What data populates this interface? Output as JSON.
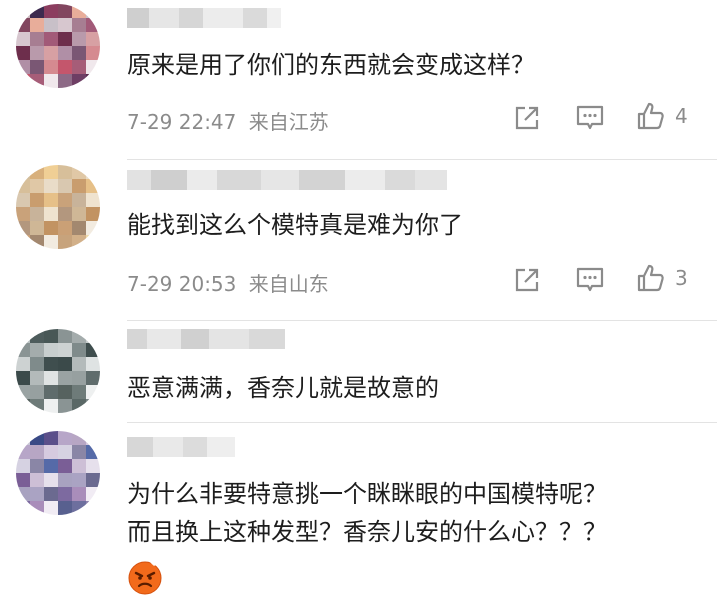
{
  "comments": [
    {
      "text_lines": [
        "原来是用了你们的东西就会变成这样？"
      ],
      "time": "7-29 22:47",
      "location": "来自江苏",
      "likes": "4",
      "avatar_palette": [
        "#c9b6bd",
        "#a77e92",
        "#d58a90",
        "#b35a6a",
        "#e8ad9a",
        "#d7a0a3",
        "#8d6a86",
        "#3d2b4f",
        "#a25a78",
        "#c4566c",
        "#e58b73",
        "#c8c0c8",
        "#b08fa6",
        "#6e3e64",
        "#8b3d5f",
        "#6d2e4c",
        "#a65d78",
        "#ddd0d6",
        "#d7c7cf",
        "#7a5774",
        "#5a2d50",
        "#82465f",
        "#b99aab",
        "#f0e8ec"
      ]
    },
    {
      "text_lines": [
        "能找到这么个模特真是难为你了"
      ],
      "time": "7-29 20:53",
      "location": "来自山东",
      "likes": "3",
      "avatar_palette": [
        "#d2bc9a",
        "#c99d6e",
        "#c29362",
        "#b88e67",
        "#e0c8a6",
        "#efe3cf",
        "#c7a37c",
        "#d8b07c",
        "#e6c088",
        "#caa076",
        "#b6967a",
        "#e9dcc8",
        "#b3977e",
        "#d2b089",
        "#f0cf95",
        "#c9a27a",
        "#a3886f",
        "#e5d6c0",
        "#d9c8b0",
        "#cfb796",
        "#eed9aa",
        "#d7bf9a",
        "#c8b39a",
        "#f2ebe0"
      ]
    },
    {
      "text_lines": [
        "恶意满满，香奈儿就是故意的"
      ],
      "avatar_palette": [
        "#b9c1c1",
        "#7f8b8b",
        "#5f6c6c",
        "#6b7777",
        "#a4acac",
        "#dfe3e3",
        "#8a9494",
        "#4e5c5c",
        "#3f4e4e",
        "#56625f",
        "#7a8684",
        "#c8cece",
        "#9aa3a3",
        "#5a6866",
        "#485756",
        "#3b4a4a",
        "#6e7b79",
        "#d4d9d9",
        "#cdd2d2",
        "#97a0a0",
        "#7b8686",
        "#8a9494",
        "#b3baba",
        "#eef0f0"
      ]
    },
    {
      "text_lines": [
        "为什么非要特意挑一个眯眯眼的中国模特呢？",
        "而且换上这种发型？香奈儿安的什么心？？？"
      ],
      "avatar_palette": [
        "#c9c6d6",
        "#8a86a6",
        "#6b6a90",
        "#8c7fa6",
        "#b7a6c4",
        "#e6e0ec",
        "#58608f",
        "#3a4a86",
        "#556aa8",
        "#7d6aa0",
        "#9f7fb5",
        "#d6cadf",
        "#a8a2c0",
        "#6d6f9e",
        "#5b4f8a",
        "#7a5e96",
        "#a98dba",
        "#e1d6e6",
        "#d6d2e2",
        "#aaa3c3",
        "#8e83ad",
        "#b7a6c8",
        "#cdbfd6",
        "#f1ecf4"
      ]
    }
  ],
  "icon_names": [
    "share-icon",
    "comment-icon",
    "like-icon",
    "angry-face-emoji"
  ],
  "colors": {
    "meta": "#8b8b8b",
    "text": "#1d1d1d",
    "divider": "#e3e3e3",
    "emoji": "#f26a1b"
  }
}
